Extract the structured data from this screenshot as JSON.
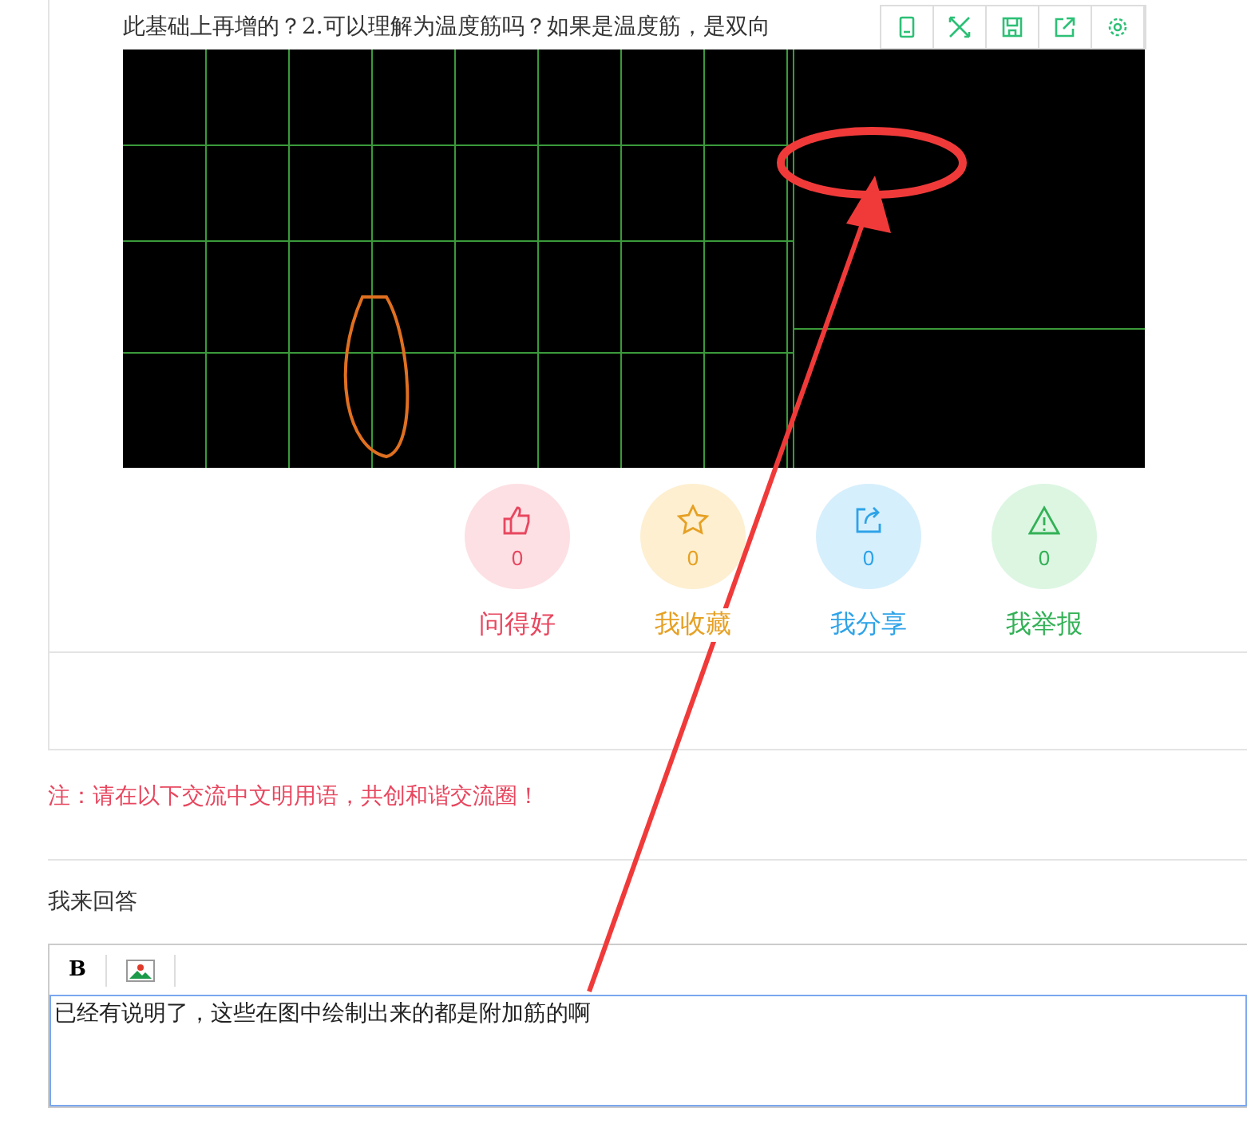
{
  "question": {
    "text_line": "此基础上再增的？2.可以理解为温度筋吗？如果是温度筋，是双向"
  },
  "image_toolbar": [
    {
      "kind": "tablet"
    },
    {
      "kind": "expand"
    },
    {
      "kind": "save"
    },
    {
      "kind": "share"
    },
    {
      "kind": "settings"
    }
  ],
  "actions": [
    {
      "kind": "like",
      "count": "0",
      "label": "问得好",
      "color": "#e8475f"
    },
    {
      "kind": "favorite",
      "count": "0",
      "label": "我收藏",
      "color": "#e6a023"
    },
    {
      "kind": "share",
      "count": "0",
      "label": "我分享",
      "color": "#2ea3e8"
    },
    {
      "kind": "report",
      "count": "0",
      "label": "我举报",
      "color": "#33b156"
    }
  ],
  "notice": "注：请在以下交流中文明用语，共创和谐交流圈！",
  "reply": {
    "heading": "我来回答",
    "bold_button": "B",
    "value": "已经有说明了，这些在图中绘制出来的都是附加筋的啊"
  }
}
